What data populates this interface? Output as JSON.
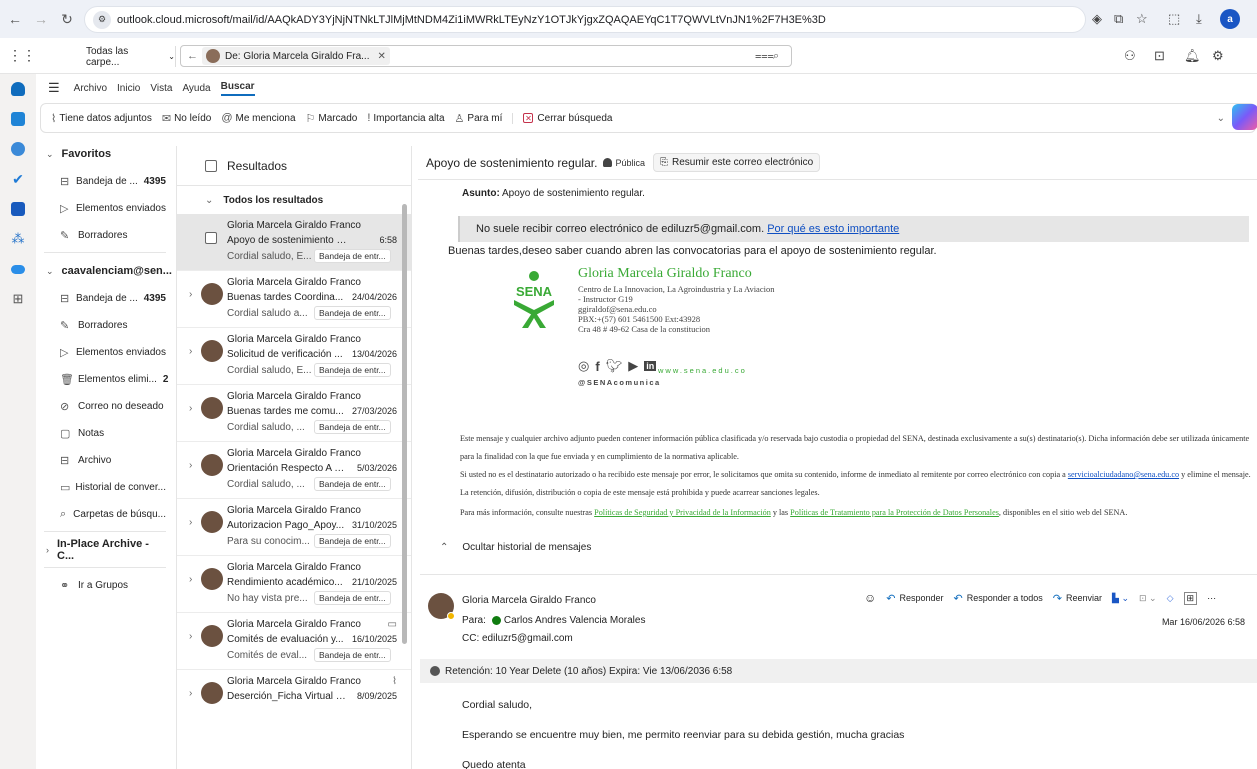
{
  "browser": {
    "url": "outlook.cloud.microsoft/mail/id/AAQkADY3YjNjNTNkLTJlMjMtNDM4Zi1iMWRkLTEyNzY1OTJkYjgxZQAQAEYqC1T7QWVLtVnJN1%2F7H3E%3D",
    "profile_initial": "a"
  },
  "topbar": {
    "folder_select": "Todas las carpe...",
    "search_chip": "De: Gloria Marcela Giraldo Fra..."
  },
  "ribbon": {
    "tabs": [
      "Archivo",
      "Inicio",
      "Vista",
      "Ayuda",
      "Buscar"
    ],
    "filters": [
      "Tiene datos adjuntos",
      "No leído",
      "Me menciona",
      "Marcado",
      "Importancia alta",
      "Para mí",
      "Cerrar búsqueda"
    ]
  },
  "folders": {
    "favorites_header": "Favoritos",
    "favorites": [
      {
        "label": "Bandeja de ...",
        "count": "4395"
      },
      {
        "label": "Elementos enviados",
        "count": ""
      },
      {
        "label": "Borradores",
        "count": ""
      }
    ],
    "account_header": "caavalenciam@sen...",
    "account": [
      {
        "label": "Bandeja de ...",
        "count": "4395"
      },
      {
        "label": "Borradores",
        "count": ""
      },
      {
        "label": "Elementos enviados",
        "count": ""
      },
      {
        "label": "Elementos elimi...",
        "count": "2"
      },
      {
        "label": "Correo no deseado",
        "count": ""
      },
      {
        "label": "Notas",
        "count": ""
      },
      {
        "label": "Archivo",
        "count": ""
      },
      {
        "label": "Historial de conver...",
        "count": ""
      },
      {
        "label": "Carpetas de búsqu...",
        "count": ""
      }
    ],
    "archive_header": "In-Place Archive -C...",
    "groups": "Ir a Grupos"
  },
  "list": {
    "header": "Resultados",
    "group": "Todos los resultados",
    "messages": [
      {
        "sender": "Gloria Marcela Giraldo Franco",
        "subject": "Apoyo de sostenimiento regul...",
        "date": "6:58",
        "preview": "Cordial saludo, E...",
        "tag": "Bandeja de entr..."
      },
      {
        "sender": "Gloria Marcela Giraldo Franco",
        "subject": "Buenas tardes Coordina...",
        "date": "24/04/2026",
        "preview": "Cordial saludo a...",
        "tag": "Bandeja de entr..."
      },
      {
        "sender": "Gloria Marcela Giraldo Franco",
        "subject": "Solicitud de verificación ...",
        "date": "13/04/2026",
        "preview": "Cordial saludo, E...",
        "tag": "Bandeja de entr..."
      },
      {
        "sender": "Gloria Marcela Giraldo Franco",
        "subject": "Buenas tardes me comu...",
        "date": "27/03/2026",
        "preview": "Cordial saludo, ...",
        "tag": "Bandeja de entr..."
      },
      {
        "sender": "Gloria Marcela Giraldo Franco",
        "subject": "Orientación Respecto A L...",
        "date": "5/03/2026",
        "preview": "Cordial saludo, ...",
        "tag": "Bandeja de entr..."
      },
      {
        "sender": "Gloria Marcela Giraldo Franco",
        "subject": "Autorizacion Pago_Apoy...",
        "date": "31/10/2025",
        "preview": "Para su conocim...",
        "tag": "Bandeja de entr..."
      },
      {
        "sender": "Gloria Marcela Giraldo Franco",
        "subject": "Rendimiento académico...",
        "date": "21/10/2025",
        "preview": "No hay vista pre...",
        "tag": "Bandeja de entr..."
      },
      {
        "sender": "Gloria Marcela Giraldo Franco",
        "subject": "Comités de evaluación y...",
        "date": "16/10/2025",
        "preview": "Comités de eval...",
        "tag": "Bandeja de entr..."
      },
      {
        "sender": "Gloria Marcela Giraldo Franco",
        "subject": "Deserción_Ficha Virtual #...",
        "date": "8/09/2025",
        "preview": "",
        "tag": ""
      }
    ]
  },
  "reading": {
    "subject": "Apoyo de sostenimiento regular.",
    "sensitivity": "Pública",
    "summarize": "Resumir este correo electrónico",
    "asunto_label": "Asunto:",
    "asunto_value": "Apoyo de sostenimiento regular.",
    "warning_text": "No suele recibir correo electrónico de ediluzr5@gmail.com.",
    "warning_link": "Por qué es esto importante",
    "body": "Buenas tardes,deseo saber cuando abren las convocatorias para el apoyo de sostenimiento regular.",
    "signature": {
      "logo_text": "SENA",
      "name": "Gloria Marcela Giraldo Franco",
      "lines": [
        "Centro de La Innovacion, La Agroindustria y La Aviacion",
        "- Instructor G19",
        "ggiraldof@sena.edu.co",
        "PBX:+(57) 601 5461500 Ext:43928",
        "Cra 48 # 49-62 Casa de la constitucion"
      ],
      "website": "www.sena.edu.co",
      "handle": "@SENAcomunica"
    },
    "disclaimer1": "Este mensaje y cualquier archivo adjunto pueden contener información pública clasificada y/o reservada bajo custodia o propiedad del SENA, destinada exclusivamente a su(s) destinatario(s). Dicha información debe ser utilizada únicamente para la finalidad con la que fue enviada y en cumplimiento de la normativa aplicable.",
    "disclaimer2a": "Si usted no es el destinatario autorizado o ha recibido este mensaje por error, le solicitamos que omita su contenido, informe de inmediato al remitente por correo electrónico con copia a",
    "disclaimer2_link": "servicioalciudadano@sena.edu.co",
    "disclaimer2b": "y elimine el mensaje. La retención, difusión, distribución o copia de este mensaje está prohibida y puede acarrear sanciones legales.",
    "disclaimer3a": "Para más información, consulte nuestras",
    "disclaimer3_link1": "Políticas de Seguridad y Privacidad de la Información",
    "disclaimer3b": "y las",
    "disclaimer3_link2": "Políticas de Tratamiento para la Protección de Datos Personales",
    "disclaimer3c": ", disponibles en el sitio web del SENA.",
    "hide_history": "Ocultar historial de mensajes"
  },
  "message2": {
    "from": "Gloria Marcela Giraldo Franco",
    "to_label": "Para:",
    "to": "Carlos Andres Valencia Morales",
    "cc": "CC: ediluzr5@gmail.com",
    "actions": [
      "Responder",
      "Responder a todos",
      "Reenviar"
    ],
    "date": "Mar 16/06/2026 6:58",
    "retention": "Retención: 10 Year Delete (10 años) Expira: Vie 13/06/2036 6:58",
    "body": [
      "Cordial saludo,",
      "Esperando se encuentre muy bien, me permito reenviar para su debida gestión, mucha gracias",
      "Quedo atenta"
    ]
  }
}
